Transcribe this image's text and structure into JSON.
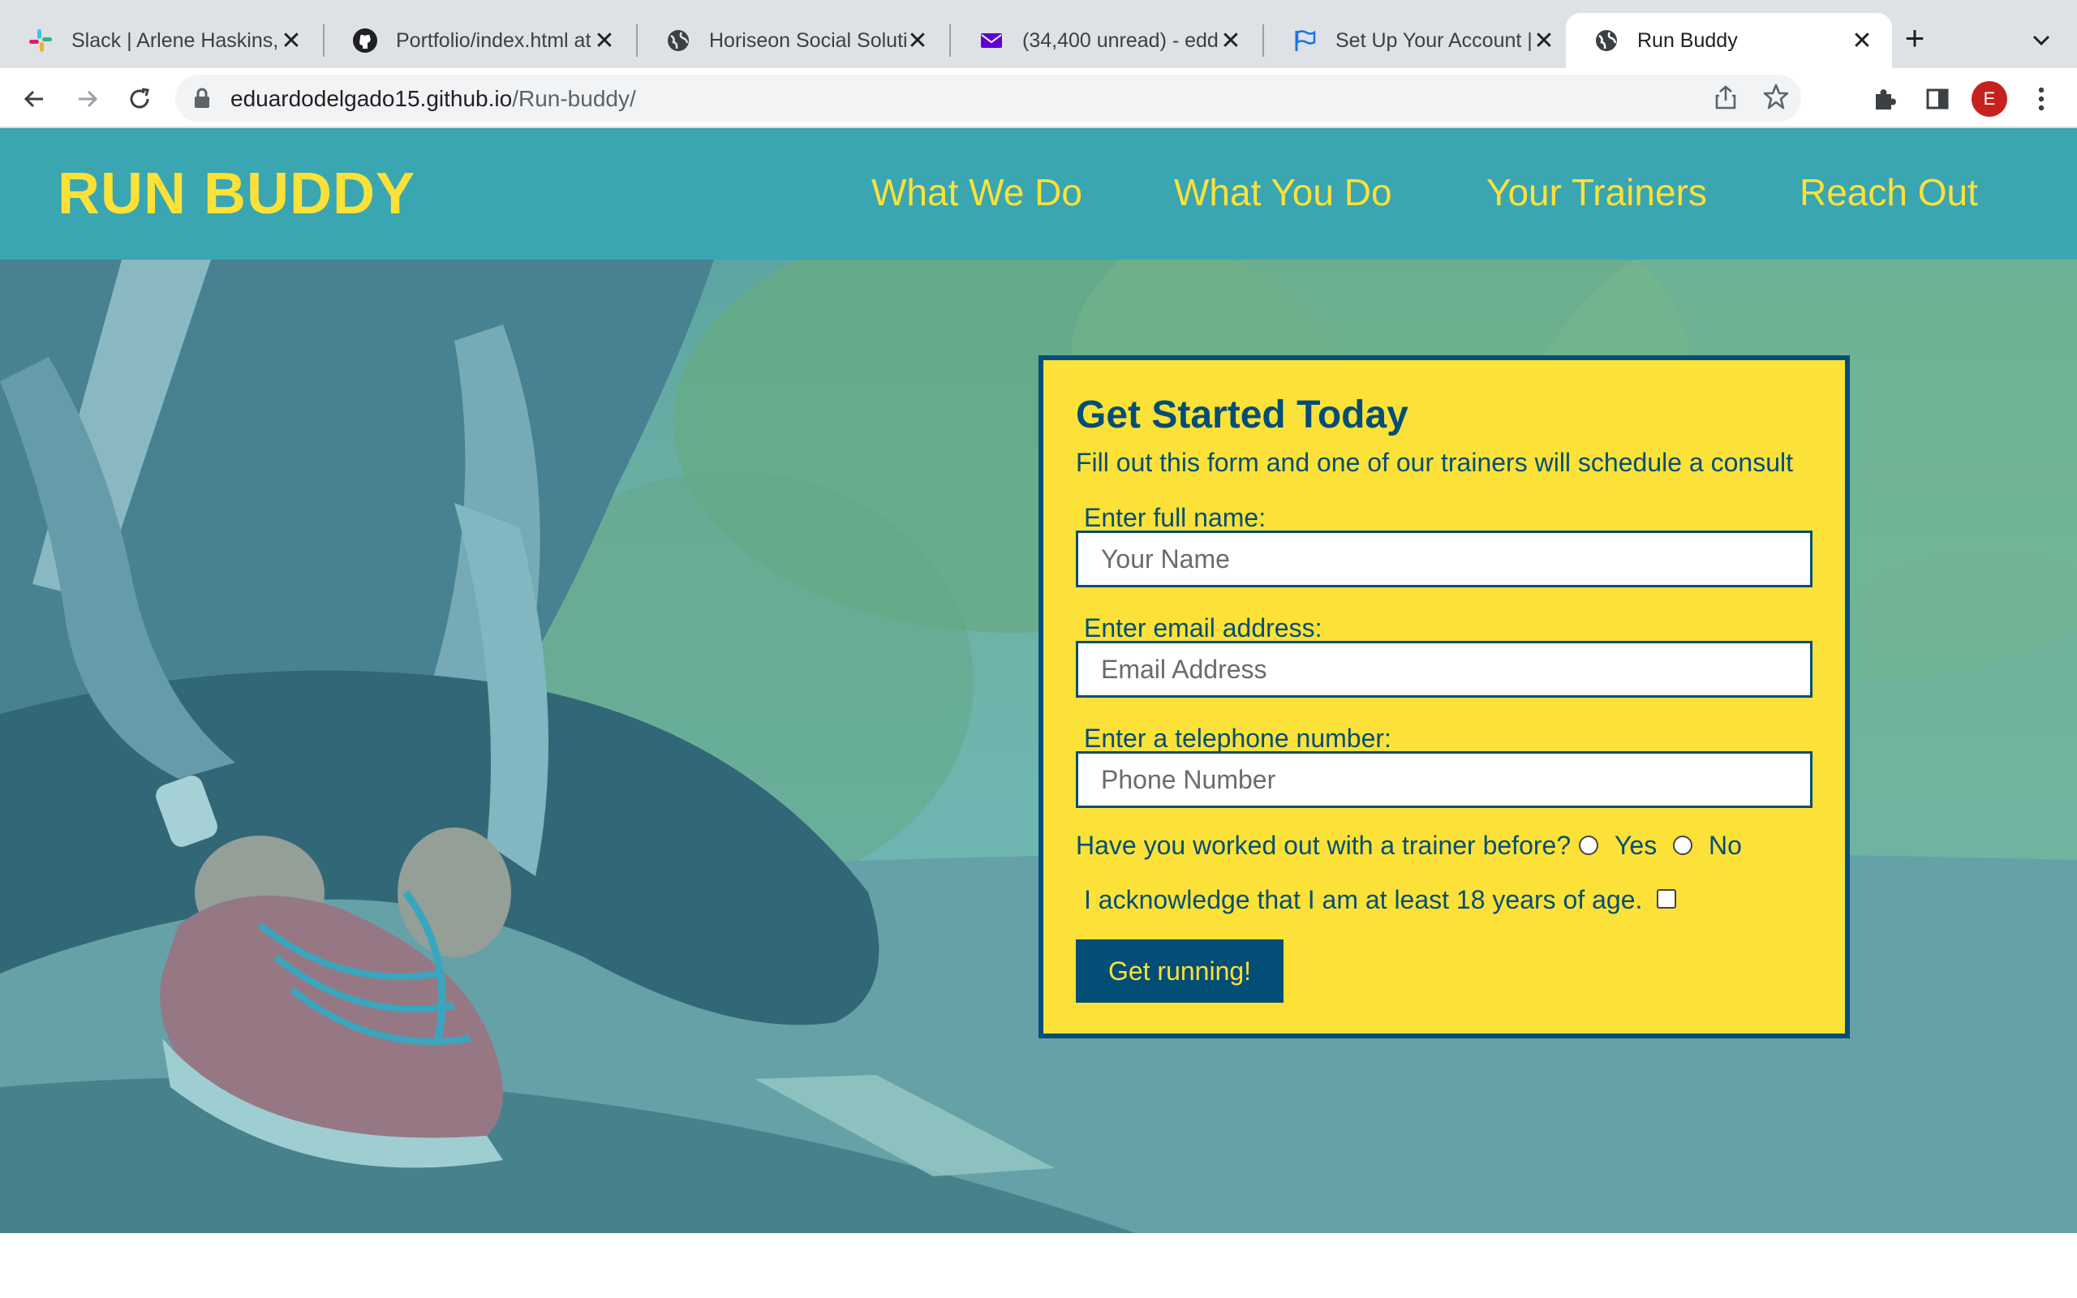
{
  "browser": {
    "tabs": [
      {
        "title": "Slack | Arlene Haskins,",
        "icon": "slack-icon",
        "active": false
      },
      {
        "title": "Portfolio/index.html at",
        "icon": "github-icon",
        "active": false
      },
      {
        "title": "Horiseon Social Soluti",
        "icon": "globe-icon",
        "active": false
      },
      {
        "title": "(34,400 unread) - edd",
        "icon": "mail-icon",
        "active": false
      },
      {
        "title": "Set Up Your Account |",
        "icon": "flag-icon",
        "active": false
      },
      {
        "title": "Run Buddy",
        "icon": "globe-icon",
        "active": true
      }
    ],
    "new_tab_label": "+",
    "address": {
      "domain": "eduardodelgado15.github.io",
      "path": "/Run-buddy/"
    },
    "profile_initial": "E"
  },
  "site": {
    "brand": "RUN BUDDY",
    "nav": [
      "What We Do",
      "What You Do",
      "Your Trainers",
      "Reach Out"
    ]
  },
  "form": {
    "title": "Get Started Today",
    "subtitle": "Fill out this form and one of our trainers will schedule a consult",
    "fields": [
      {
        "label": "Enter full name:",
        "placeholder": "Your Name",
        "value": ""
      },
      {
        "label": "Enter email address:",
        "placeholder": "Email Address",
        "value": ""
      },
      {
        "label": "Enter a telephone number:",
        "placeholder": "Phone Number",
        "value": ""
      }
    ],
    "trainer_question": "Have you worked out with a trainer before?",
    "trainer_options": [
      "Yes",
      "No"
    ],
    "acknowledge": "I acknowledge that I am at least 18 years of age.",
    "submit_label": "Get running!"
  },
  "colors": {
    "header_bg": "#39a6b2",
    "accent_yellow": "#fce138",
    "dark_blue": "#024e76"
  }
}
